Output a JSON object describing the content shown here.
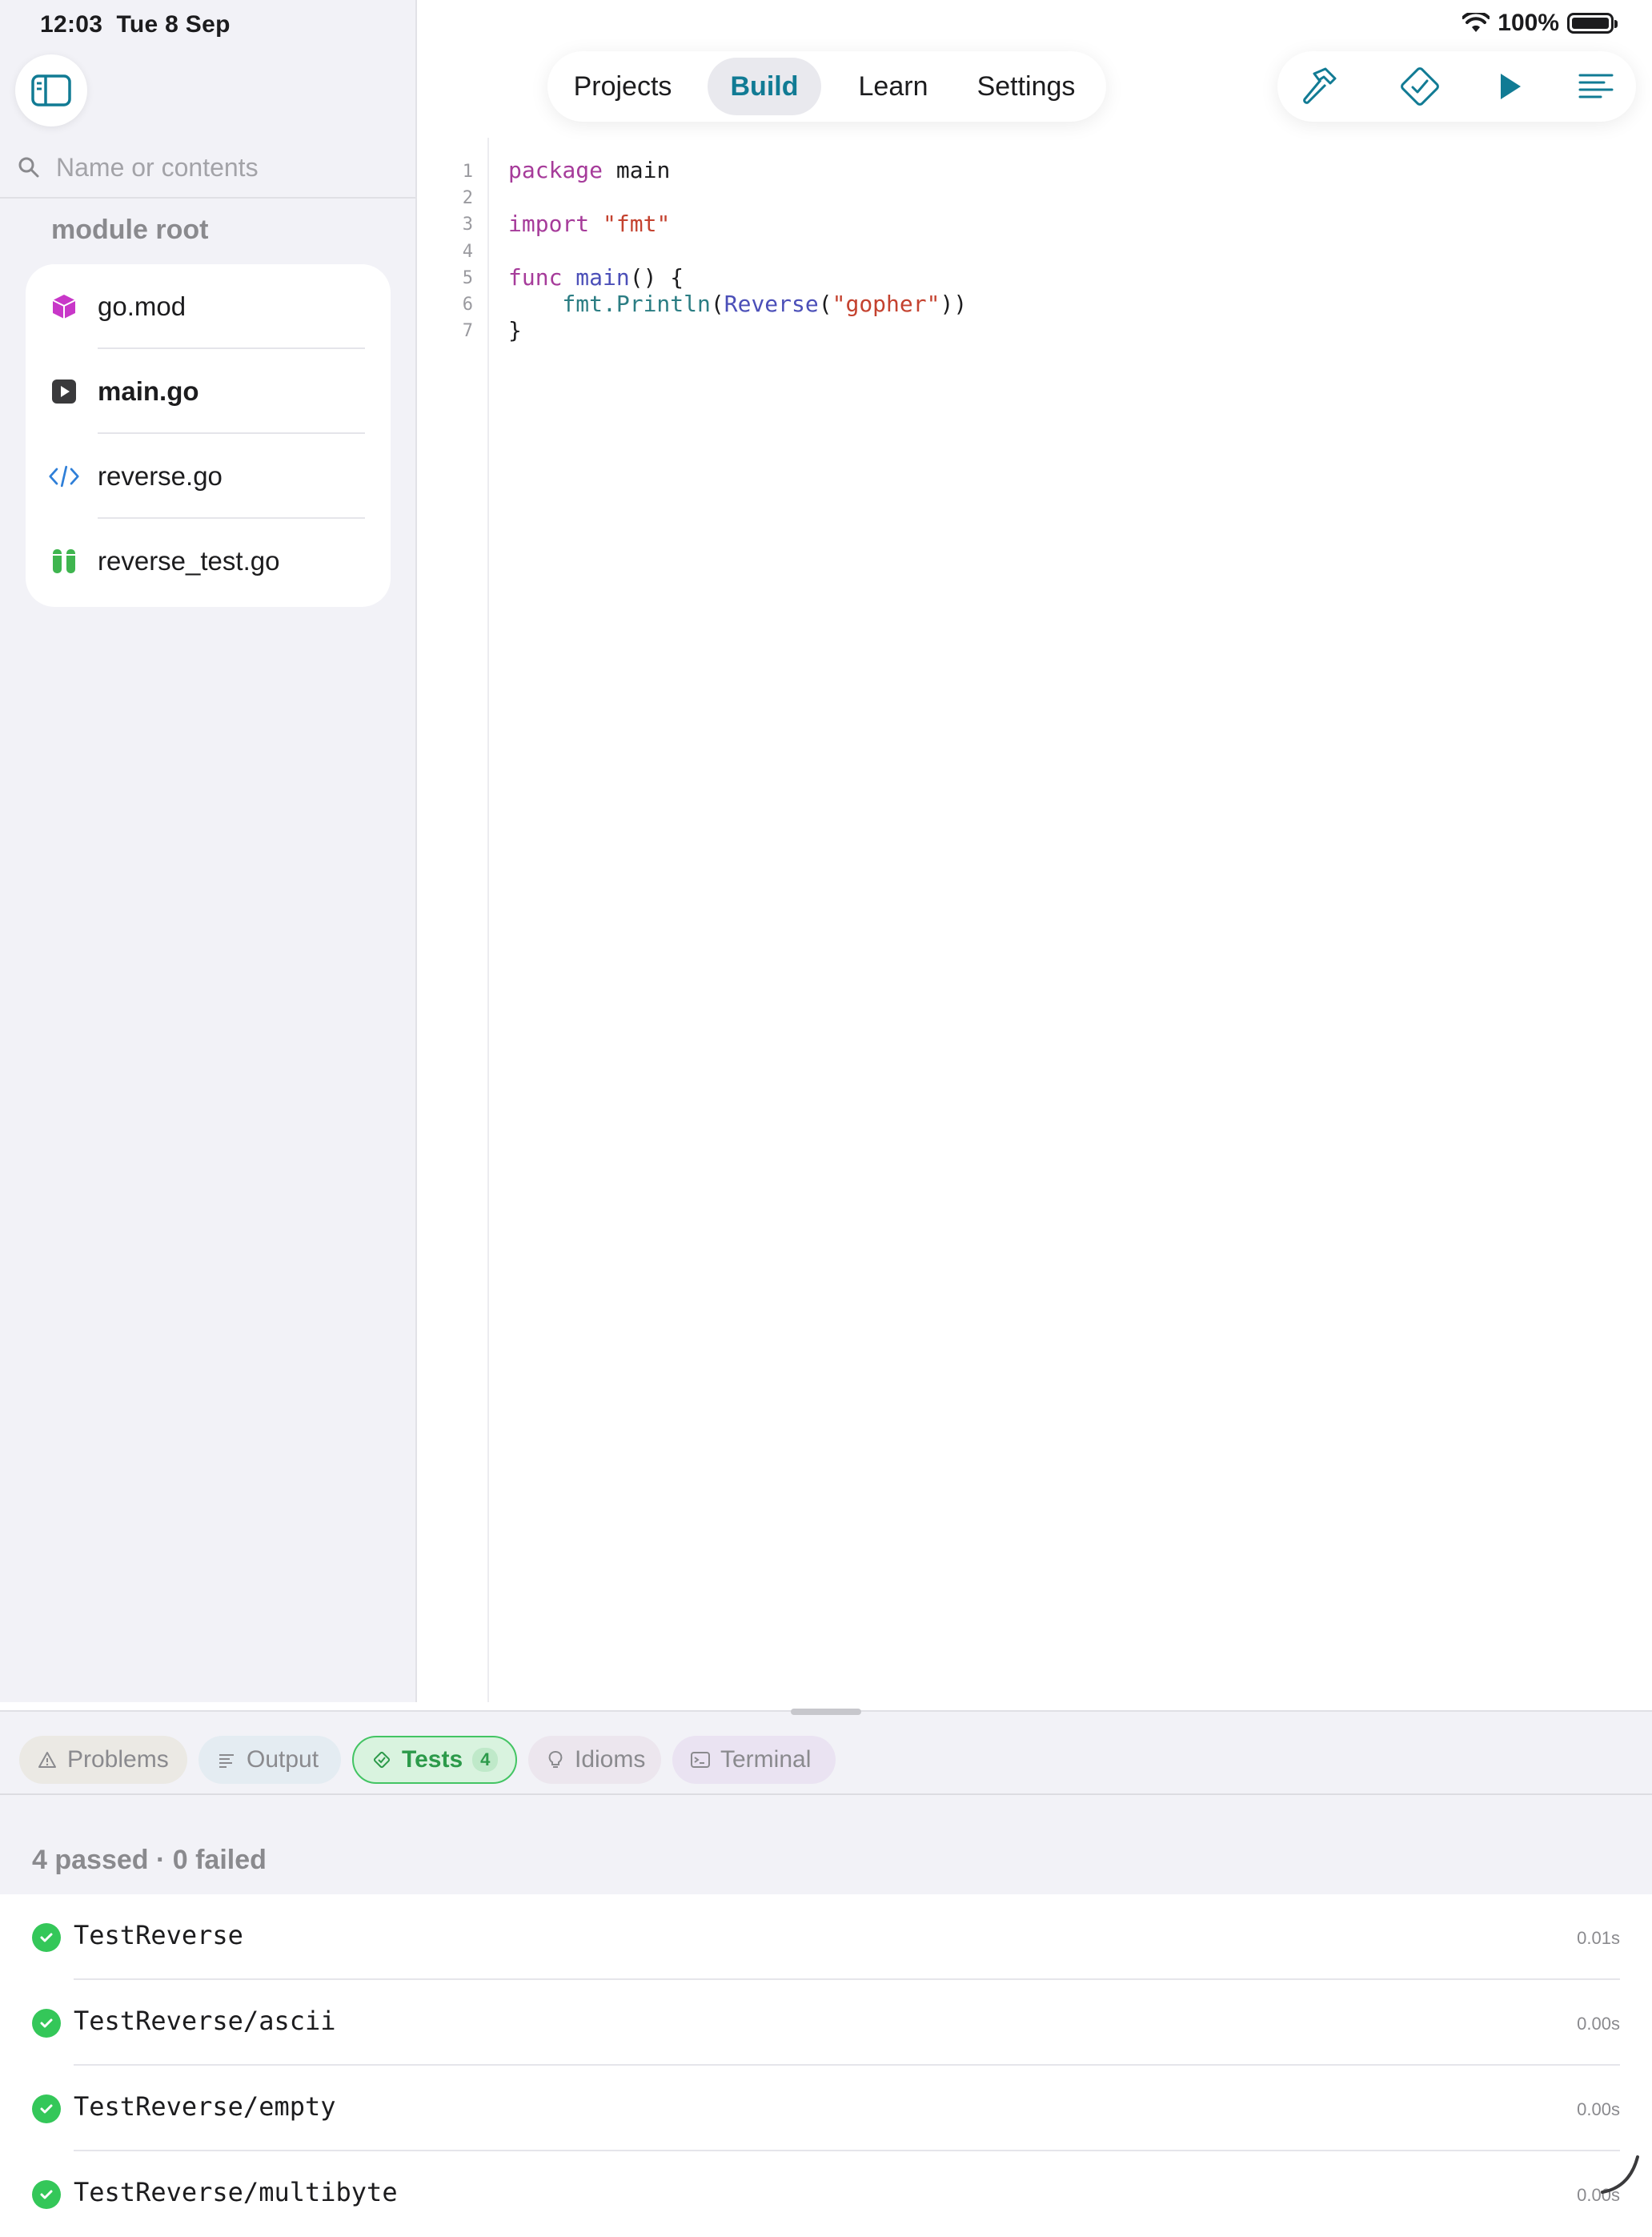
{
  "status_bar": {
    "time": "12:03",
    "date": "Tue 8 Sep",
    "battery": "100%"
  },
  "sidebar": {
    "search_placeholder": "Name or contents",
    "section_title": "module root",
    "files": [
      {
        "name": "go.mod",
        "icon": "package-cube-icon",
        "bold": false
      },
      {
        "name": "main.go",
        "icon": "play-square-icon",
        "bold": true
      },
      {
        "name": "reverse.go",
        "icon": "code-brackets-icon",
        "bold": false
      },
      {
        "name": "reverse_test.go",
        "icon": "test-tubes-icon",
        "bold": false
      }
    ]
  },
  "nav": {
    "tabs": [
      {
        "label": "Projects"
      },
      {
        "label": "Build",
        "active": true
      },
      {
        "label": "Learn"
      },
      {
        "label": "Settings"
      }
    ]
  },
  "toolbar": {
    "buttons": [
      "hammer-icon",
      "diamond-check-icon",
      "play-icon",
      "lines-icon"
    ]
  },
  "editor": {
    "line_numbers": [
      "1",
      "2",
      "3",
      "4",
      "5",
      "6",
      "7"
    ],
    "lines": [
      {
        "kw": "package",
        "rest": " main"
      },
      {
        "text": ""
      },
      {
        "kw": "import",
        "str": " \"fmt\""
      },
      {
        "text": ""
      },
      {
        "kw": "func",
        "fn": " main",
        "rest": "() {"
      },
      {
        "pkg": "    fmt.",
        "fn": "Println",
        "p1": "(",
        "fn2": "Reverse",
        "p2": "(",
        "str": "\"gopher\"",
        "p3": "))"
      },
      {
        "text": "}"
      }
    ]
  },
  "panel": {
    "tabs": [
      {
        "label": "Problems",
        "icon": "warning-triangle-icon",
        "bg": "#ebe9e4",
        "color": "#8a8a8e"
      },
      {
        "label": "Output",
        "icon": "text-lines-icon",
        "bg": "#e4ecf2",
        "color": "#8a8a8e"
      },
      {
        "label": "Tests",
        "icon": "diamond-check-icon",
        "badge": "4",
        "bg": "#d9f3df",
        "color": "#2c9a4a",
        "active": true
      },
      {
        "label": "Idioms",
        "icon": "lightbulb-icon",
        "bg": "#ece6ee",
        "color": "#8a8a8e"
      },
      {
        "label": "Terminal",
        "icon": "terminal-icon",
        "bg": "#eae3f2",
        "color": "#8a8a8e"
      }
    ],
    "summary": "4 passed · 0 failed",
    "results": [
      {
        "name": "TestReverse",
        "duration": "0.01s"
      },
      {
        "name": "TestReverse/ascii",
        "duration": "0.00s"
      },
      {
        "name": "TestReverse/empty",
        "duration": "0.00s"
      },
      {
        "name": "TestReverse/multibyte",
        "duration": "0.00s"
      }
    ]
  },
  "colors": {
    "accent": "#117b94",
    "pass": "#34c759",
    "keyword": "#a63b9a",
    "string": "#c4422f",
    "function": "#4b4fb8"
  }
}
